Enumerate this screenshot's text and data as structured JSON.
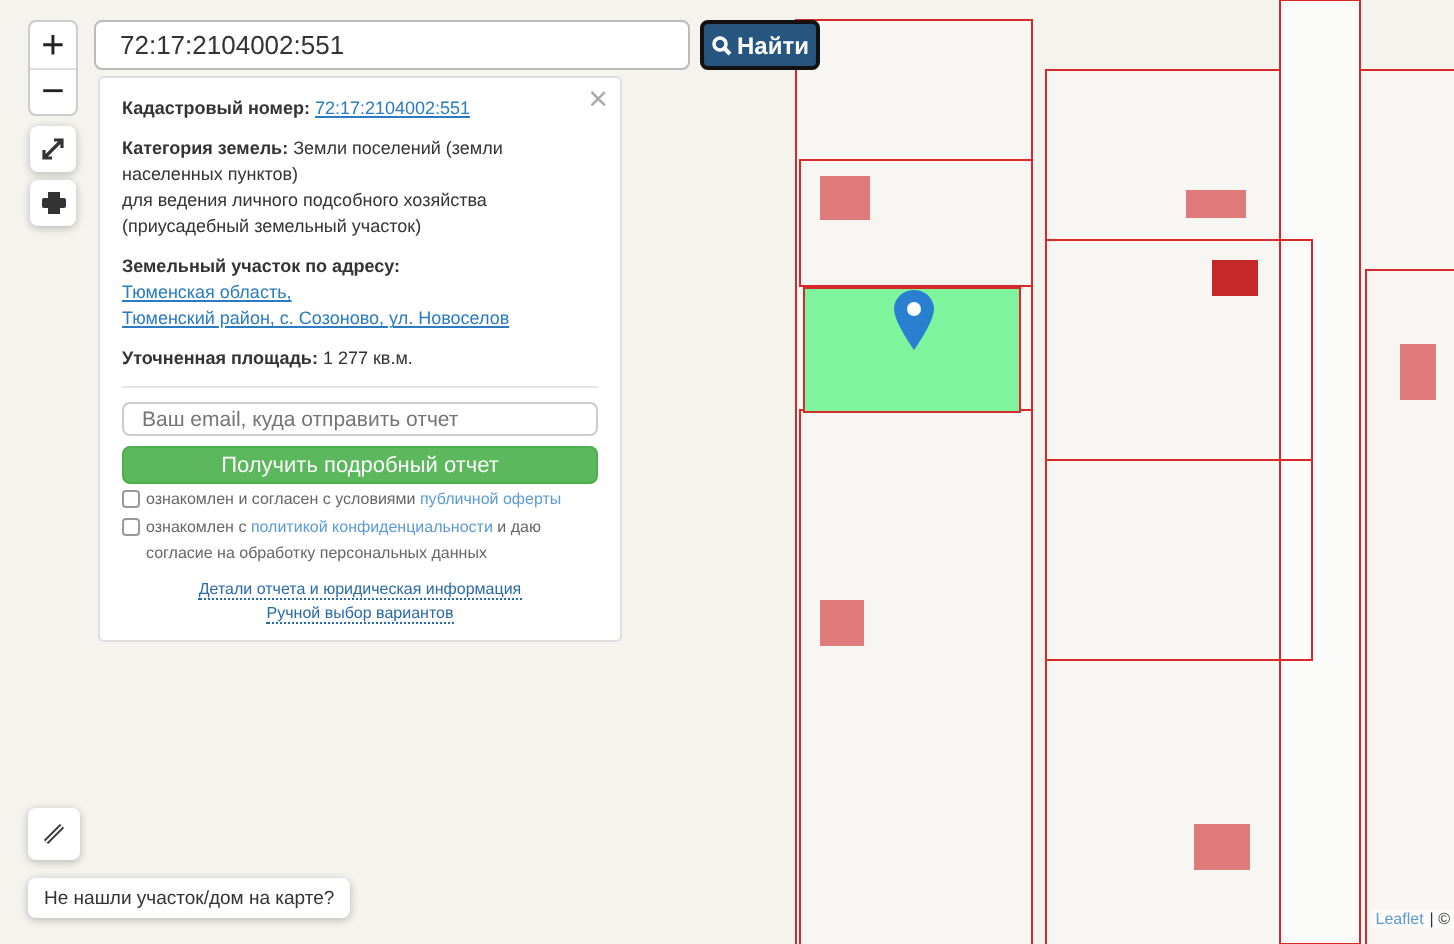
{
  "search": {
    "value": "72:17:2104002:551",
    "button": "Найти"
  },
  "zoom": {
    "in": "+",
    "out": "−"
  },
  "popup": {
    "close": "×",
    "fields": [
      {
        "label": "Кадастровый номер:",
        "value": "72:17:2104002:551",
        "kind": "link"
      },
      {
        "label": "Категория земель:",
        "value": "Земли поселений (земли населенных пунктов)\nдля ведения личного подсобного хозяйства (приусадебный земельный участок)",
        "kind": "text"
      },
      {
        "label": "Земельный участок по адресу:",
        "value": "Тюменская область,",
        "more": "Тюменский район, с. Созоново, ул. Новоселов",
        "kind": "link"
      },
      {
        "label": "Уточненная площадь:",
        "value": "1 277 кв.м.",
        "kind": "text"
      }
    ],
    "email": {
      "placeholder": "Ваш email, куда отправить отчет"
    },
    "submit": "Получить подробный отчет",
    "agreements": [
      {
        "checked": false,
        "before": "ознакомлен и согласен с условиями",
        "link": "публичной оферты"
      },
      {
        "checked": false,
        "before": "ознакомлен с",
        "link": "политикой конфиденциальности",
        "after": "и даю согласие на обработку персональных данных"
      }
    ],
    "links": [
      "Детали отчета и юридическая информация",
      "Ручной выбор вариантов"
    ]
  },
  "not_found": "Не нашли участок/дом на карте?",
  "attribution": {
    "link": "Leaflet",
    "rest": "| ©"
  }
}
